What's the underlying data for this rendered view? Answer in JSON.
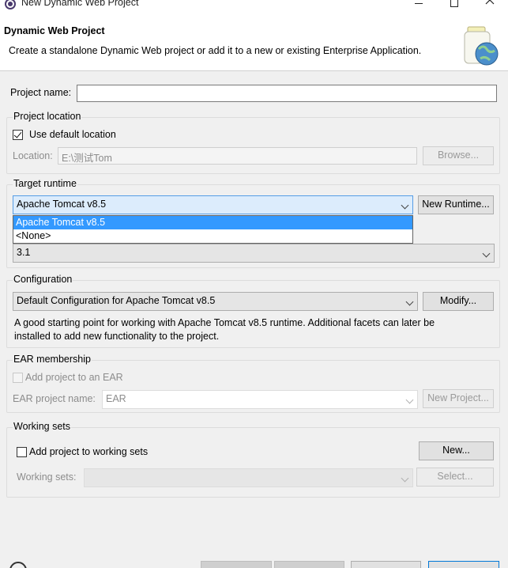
{
  "window": {
    "title": "New Dynamic Web Project"
  },
  "banner": {
    "heading": "Dynamic Web Project",
    "description": "Create a standalone Dynamic Web project or add it to a new or existing Enterprise Application."
  },
  "project_name": {
    "label": "Project name:",
    "value": ""
  },
  "project_location": {
    "group_title": "Project location",
    "use_default_label": "Use default location",
    "use_default_checked": true,
    "location_label": "Location:",
    "location_value": "E:\\测试Tom",
    "browse_label": "Browse..."
  },
  "target_runtime": {
    "group_title": "Target runtime",
    "selected": "Apache Tomcat v8.5",
    "new_runtime_label": "New Runtime...",
    "options": [
      "Apache Tomcat v8.5",
      "<None>"
    ]
  },
  "module_version": {
    "selected": "3.1"
  },
  "configuration": {
    "group_title": "Configuration",
    "selected": "Default Configuration for Apache Tomcat v8.5",
    "modify_label": "Modify...",
    "description_line1": "A good starting point for working with Apache Tomcat v8.5 runtime. Additional facets can later be",
    "description_line2": "installed to add new functionality to the project."
  },
  "ear_membership": {
    "group_title": "EAR membership",
    "add_label": "Add project to an EAR",
    "add_checked": false,
    "ear_name_label": "EAR project name:",
    "ear_name_value": "EAR",
    "new_project_label": "New Project..."
  },
  "working_sets": {
    "group_title": "Working sets",
    "add_label": "Add project to working sets",
    "add_checked": false,
    "new_label": "New...",
    "sets_label": "Working sets:",
    "sets_value": "",
    "select_label": "Select..."
  },
  "colors": {
    "selection": "#3399ff",
    "combo_open": "#dcecfc",
    "dialog_bg": "#f0f0f0"
  }
}
